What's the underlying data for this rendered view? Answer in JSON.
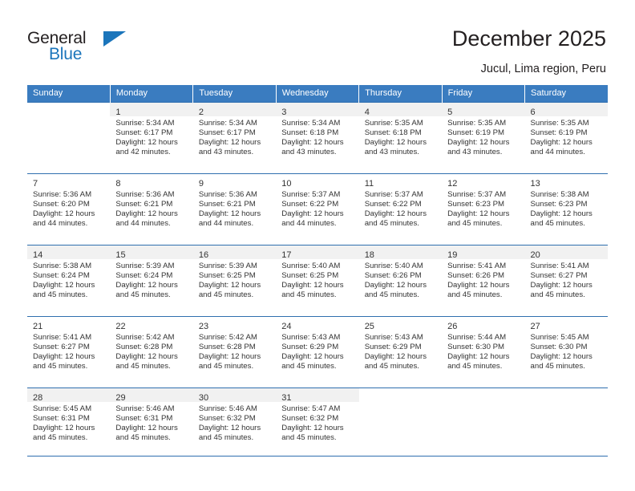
{
  "brand": {
    "name_part1": "General",
    "name_part2": "Blue",
    "triangle_icon": "triangle-icon",
    "accent_color": "#1b75bb"
  },
  "header": {
    "title": "December 2025",
    "subtitle": "Jucul, Lima region, Peru"
  },
  "calendar": {
    "header_color": "#3a7cc0",
    "weekdays": [
      "Sunday",
      "Monday",
      "Tuesday",
      "Wednesday",
      "Thursday",
      "Friday",
      "Saturday"
    ],
    "weeks": [
      {
        "shaded": true,
        "days": [
          {
            "num": "",
            "sunrise": "",
            "sunset": "",
            "daylight1": "",
            "daylight2": "",
            "empty": true
          },
          {
            "num": "1",
            "sunrise": "Sunrise: 5:34 AM",
            "sunset": "Sunset: 6:17 PM",
            "daylight1": "Daylight: 12 hours",
            "daylight2": "and 42 minutes.",
            "empty": false
          },
          {
            "num": "2",
            "sunrise": "Sunrise: 5:34 AM",
            "sunset": "Sunset: 6:17 PM",
            "daylight1": "Daylight: 12 hours",
            "daylight2": "and 43 minutes.",
            "empty": false
          },
          {
            "num": "3",
            "sunrise": "Sunrise: 5:34 AM",
            "sunset": "Sunset: 6:18 PM",
            "daylight1": "Daylight: 12 hours",
            "daylight2": "and 43 minutes.",
            "empty": false
          },
          {
            "num": "4",
            "sunrise": "Sunrise: 5:35 AM",
            "sunset": "Sunset: 6:18 PM",
            "daylight1": "Daylight: 12 hours",
            "daylight2": "and 43 minutes.",
            "empty": false
          },
          {
            "num": "5",
            "sunrise": "Sunrise: 5:35 AM",
            "sunset": "Sunset: 6:19 PM",
            "daylight1": "Daylight: 12 hours",
            "daylight2": "and 43 minutes.",
            "empty": false
          },
          {
            "num": "6",
            "sunrise": "Sunrise: 5:35 AM",
            "sunset": "Sunset: 6:19 PM",
            "daylight1": "Daylight: 12 hours",
            "daylight2": "and 44 minutes.",
            "empty": false
          }
        ]
      },
      {
        "shaded": false,
        "days": [
          {
            "num": "7",
            "sunrise": "Sunrise: 5:36 AM",
            "sunset": "Sunset: 6:20 PM",
            "daylight1": "Daylight: 12 hours",
            "daylight2": "and 44 minutes.",
            "empty": false
          },
          {
            "num": "8",
            "sunrise": "Sunrise: 5:36 AM",
            "sunset": "Sunset: 6:21 PM",
            "daylight1": "Daylight: 12 hours",
            "daylight2": "and 44 minutes.",
            "empty": false
          },
          {
            "num": "9",
            "sunrise": "Sunrise: 5:36 AM",
            "sunset": "Sunset: 6:21 PM",
            "daylight1": "Daylight: 12 hours",
            "daylight2": "and 44 minutes.",
            "empty": false
          },
          {
            "num": "10",
            "sunrise": "Sunrise: 5:37 AM",
            "sunset": "Sunset: 6:22 PM",
            "daylight1": "Daylight: 12 hours",
            "daylight2": "and 44 minutes.",
            "empty": false
          },
          {
            "num": "11",
            "sunrise": "Sunrise: 5:37 AM",
            "sunset": "Sunset: 6:22 PM",
            "daylight1": "Daylight: 12 hours",
            "daylight2": "and 45 minutes.",
            "empty": false
          },
          {
            "num": "12",
            "sunrise": "Sunrise: 5:37 AM",
            "sunset": "Sunset: 6:23 PM",
            "daylight1": "Daylight: 12 hours",
            "daylight2": "and 45 minutes.",
            "empty": false
          },
          {
            "num": "13",
            "sunrise": "Sunrise: 5:38 AM",
            "sunset": "Sunset: 6:23 PM",
            "daylight1": "Daylight: 12 hours",
            "daylight2": "and 45 minutes.",
            "empty": false
          }
        ]
      },
      {
        "shaded": true,
        "days": [
          {
            "num": "14",
            "sunrise": "Sunrise: 5:38 AM",
            "sunset": "Sunset: 6:24 PM",
            "daylight1": "Daylight: 12 hours",
            "daylight2": "and 45 minutes.",
            "empty": false
          },
          {
            "num": "15",
            "sunrise": "Sunrise: 5:39 AM",
            "sunset": "Sunset: 6:24 PM",
            "daylight1": "Daylight: 12 hours",
            "daylight2": "and 45 minutes.",
            "empty": false
          },
          {
            "num": "16",
            "sunrise": "Sunrise: 5:39 AM",
            "sunset": "Sunset: 6:25 PM",
            "daylight1": "Daylight: 12 hours",
            "daylight2": "and 45 minutes.",
            "empty": false
          },
          {
            "num": "17",
            "sunrise": "Sunrise: 5:40 AM",
            "sunset": "Sunset: 6:25 PM",
            "daylight1": "Daylight: 12 hours",
            "daylight2": "and 45 minutes.",
            "empty": false
          },
          {
            "num": "18",
            "sunrise": "Sunrise: 5:40 AM",
            "sunset": "Sunset: 6:26 PM",
            "daylight1": "Daylight: 12 hours",
            "daylight2": "and 45 minutes.",
            "empty": false
          },
          {
            "num": "19",
            "sunrise": "Sunrise: 5:41 AM",
            "sunset": "Sunset: 6:26 PM",
            "daylight1": "Daylight: 12 hours",
            "daylight2": "and 45 minutes.",
            "empty": false
          },
          {
            "num": "20",
            "sunrise": "Sunrise: 5:41 AM",
            "sunset": "Sunset: 6:27 PM",
            "daylight1": "Daylight: 12 hours",
            "daylight2": "and 45 minutes.",
            "empty": false
          }
        ]
      },
      {
        "shaded": false,
        "days": [
          {
            "num": "21",
            "sunrise": "Sunrise: 5:41 AM",
            "sunset": "Sunset: 6:27 PM",
            "daylight1": "Daylight: 12 hours",
            "daylight2": "and 45 minutes.",
            "empty": false
          },
          {
            "num": "22",
            "sunrise": "Sunrise: 5:42 AM",
            "sunset": "Sunset: 6:28 PM",
            "daylight1": "Daylight: 12 hours",
            "daylight2": "and 45 minutes.",
            "empty": false
          },
          {
            "num": "23",
            "sunrise": "Sunrise: 5:42 AM",
            "sunset": "Sunset: 6:28 PM",
            "daylight1": "Daylight: 12 hours",
            "daylight2": "and 45 minutes.",
            "empty": false
          },
          {
            "num": "24",
            "sunrise": "Sunrise: 5:43 AM",
            "sunset": "Sunset: 6:29 PM",
            "daylight1": "Daylight: 12 hours",
            "daylight2": "and 45 minutes.",
            "empty": false
          },
          {
            "num": "25",
            "sunrise": "Sunrise: 5:43 AM",
            "sunset": "Sunset: 6:29 PM",
            "daylight1": "Daylight: 12 hours",
            "daylight2": "and 45 minutes.",
            "empty": false
          },
          {
            "num": "26",
            "sunrise": "Sunrise: 5:44 AM",
            "sunset": "Sunset: 6:30 PM",
            "daylight1": "Daylight: 12 hours",
            "daylight2": "and 45 minutes.",
            "empty": false
          },
          {
            "num": "27",
            "sunrise": "Sunrise: 5:45 AM",
            "sunset": "Sunset: 6:30 PM",
            "daylight1": "Daylight: 12 hours",
            "daylight2": "and 45 minutes.",
            "empty": false
          }
        ]
      },
      {
        "shaded": true,
        "days": [
          {
            "num": "28",
            "sunrise": "Sunrise: 5:45 AM",
            "sunset": "Sunset: 6:31 PM",
            "daylight1": "Daylight: 12 hours",
            "daylight2": "and 45 minutes.",
            "empty": false
          },
          {
            "num": "29",
            "sunrise": "Sunrise: 5:46 AM",
            "sunset": "Sunset: 6:31 PM",
            "daylight1": "Daylight: 12 hours",
            "daylight2": "and 45 minutes.",
            "empty": false
          },
          {
            "num": "30",
            "sunrise": "Sunrise: 5:46 AM",
            "sunset": "Sunset: 6:32 PM",
            "daylight1": "Daylight: 12 hours",
            "daylight2": "and 45 minutes.",
            "empty": false
          },
          {
            "num": "31",
            "sunrise": "Sunrise: 5:47 AM",
            "sunset": "Sunset: 6:32 PM",
            "daylight1": "Daylight: 12 hours",
            "daylight2": "and 45 minutes.",
            "empty": false
          },
          {
            "num": "",
            "sunrise": "",
            "sunset": "",
            "daylight1": "",
            "daylight2": "",
            "empty": true
          },
          {
            "num": "",
            "sunrise": "",
            "sunset": "",
            "daylight1": "",
            "daylight2": "",
            "empty": true
          },
          {
            "num": "",
            "sunrise": "",
            "sunset": "",
            "daylight1": "",
            "daylight2": "",
            "empty": true
          }
        ]
      }
    ]
  }
}
